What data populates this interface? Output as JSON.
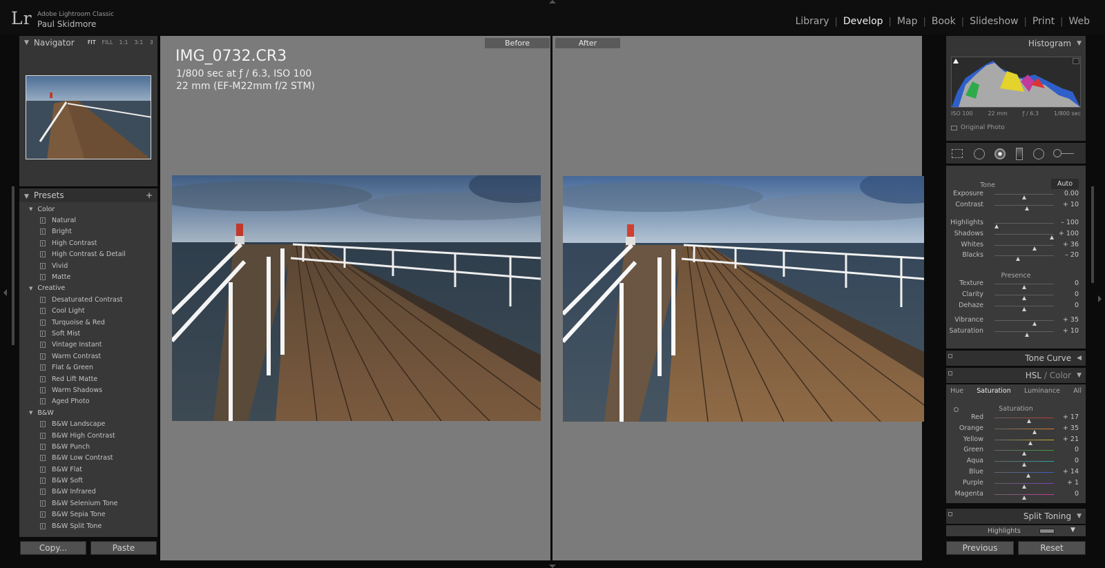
{
  "app": {
    "logo": "Lr",
    "product": "Adobe Lightroom Classic",
    "user": "Paul Skidmore"
  },
  "modules": [
    {
      "label": "Library",
      "active": false
    },
    {
      "label": "Develop",
      "active": true
    },
    {
      "label": "Map",
      "active": false
    },
    {
      "label": "Book",
      "active": false
    },
    {
      "label": "Slideshow",
      "active": false
    },
    {
      "label": "Print",
      "active": false
    },
    {
      "label": "Web",
      "active": false
    }
  ],
  "navigator": {
    "title": "Navigator",
    "options": [
      "FIT",
      "FILL",
      "1:1",
      "3:1"
    ],
    "selected": "FIT"
  },
  "presets": {
    "title": "Presets",
    "add_icon": "+",
    "groups": [
      {
        "name": "Color",
        "items": [
          "Natural",
          "Bright",
          "High Contrast",
          "High Contrast & Detail",
          "Vivid",
          "Matte"
        ]
      },
      {
        "name": "Creative",
        "items": [
          "Desaturated Contrast",
          "Cool Light",
          "Turquoise & Red",
          "Soft Mist",
          "Vintage Instant",
          "Warm Contrast",
          "Flat & Green",
          "Red Lift Matte",
          "Warm Shadows",
          "Aged Photo"
        ]
      },
      {
        "name": "B&W",
        "items": [
          "B&W Landscape",
          "B&W High Contrast",
          "B&W Punch",
          "B&W Low Contrast",
          "B&W Flat",
          "B&W Soft",
          "B&W Infrared",
          "B&W Selenium Tone",
          "B&W Sepia Tone",
          "B&W Split Tone"
        ]
      }
    ]
  },
  "left_buttons": {
    "copy": "Copy...",
    "paste": "Paste"
  },
  "view": {
    "before_label": "Before",
    "after_label": "After",
    "filename": "IMG_0732.CR3",
    "exif_line1": "1/800 sec at ƒ / 6.3, ISO 100",
    "exif_line2": "22 mm (EF-M22mm f/2 STM)"
  },
  "histogram": {
    "title": "Histogram",
    "info": [
      "ISO 100",
      "22 mm",
      "ƒ / 6.3",
      "1/800 sec"
    ],
    "original_photo": "Original Photo"
  },
  "tools": [
    "crop-overlay-icon",
    "spot-removal-icon",
    "red-eye-icon",
    "graduated-filter-icon",
    "radial-filter-icon",
    "adjustment-brush-icon"
  ],
  "basic": {
    "tone_label": "Tone",
    "auto_label": "Auto",
    "tone": [
      {
        "label": "Exposure",
        "value": "0.00",
        "pos": 0.5
      },
      {
        "label": "Contrast",
        "value": "+ 10",
        "pos": 0.55
      }
    ],
    "tone2": [
      {
        "label": "Highlights",
        "value": "– 100",
        "pos": 0.03
      },
      {
        "label": "Shadows",
        "value": "+ 100",
        "pos": 0.97
      },
      {
        "label": "Whites",
        "value": "+ 36",
        "pos": 0.68
      },
      {
        "label": "Blacks",
        "value": "– 20",
        "pos": 0.4
      }
    ],
    "presence_label": "Presence",
    "presence": [
      {
        "label": "Texture",
        "value": "0",
        "pos": 0.5
      },
      {
        "label": "Clarity",
        "value": "0",
        "pos": 0.5
      },
      {
        "label": "Dehaze",
        "value": "0",
        "pos": 0.5
      }
    ],
    "presence2": [
      {
        "label": "Vibrance",
        "value": "+ 35",
        "pos": 0.67
      },
      {
        "label": "Saturation",
        "value": "+ 10",
        "pos": 0.55
      }
    ]
  },
  "tone_curve": {
    "title": "Tone Curve"
  },
  "hsl": {
    "title": "HSL",
    "title_sep": " / ",
    "title_alt": "Color",
    "tabs": [
      "Hue",
      "Saturation",
      "Luminance",
      "All"
    ],
    "active_tab": "Saturation",
    "section": "Saturation",
    "rows": [
      {
        "label": "Red",
        "value": "+ 17",
        "pos": 0.58,
        "color": "#c0392b"
      },
      {
        "label": "Orange",
        "value": "+ 35",
        "pos": 0.67,
        "color": "#d9822b"
      },
      {
        "label": "Yellow",
        "value": "+ 21",
        "pos": 0.6,
        "color": "#c9b52d"
      },
      {
        "label": "Green",
        "value": "0",
        "pos": 0.5,
        "color": "#3e9e3e"
      },
      {
        "label": "Aqua",
        "value": "0",
        "pos": 0.5,
        "color": "#2fa3a3"
      },
      {
        "label": "Blue",
        "value": "+ 14",
        "pos": 0.57,
        "color": "#3a5fc9"
      },
      {
        "label": "Purple",
        "value": "+ 1",
        "pos": 0.5,
        "color": "#7d3fbd"
      },
      {
        "label": "Magenta",
        "value": "0",
        "pos": 0.5,
        "color": "#c23aa1"
      }
    ]
  },
  "split_toning": {
    "title": "Split Toning",
    "highlights": "Highlights"
  },
  "right_buttons": {
    "previous": "Previous",
    "reset": "Reset"
  }
}
